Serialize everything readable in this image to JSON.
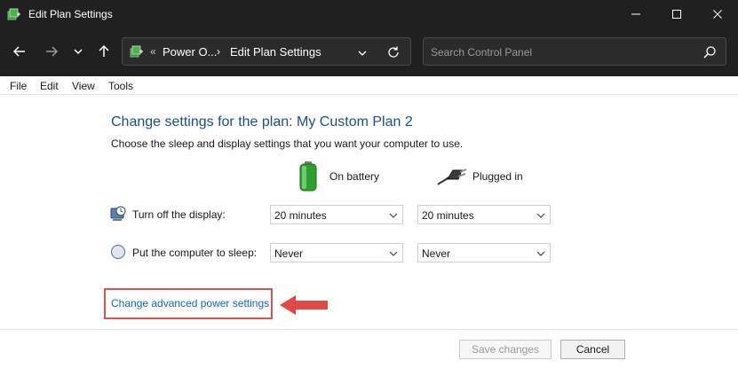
{
  "window": {
    "title": "Edit Plan Settings"
  },
  "address_bar": {
    "separator": "«",
    "crumbs": [
      "Power O...",
      "Edit Plan Settings"
    ],
    "arrow": "›"
  },
  "search": {
    "placeholder": "Search Control Panel"
  },
  "menu": {
    "items": [
      "File",
      "Edit",
      "View",
      "Tools"
    ]
  },
  "content": {
    "heading": "Change settings for the plan: My Custom Plan 2",
    "subheading": "Choose the sleep and display settings that you want your computer to use.",
    "columns": {
      "battery": "On battery",
      "plugged": "Plugged in"
    },
    "rows": [
      {
        "label": "Turn off the display:",
        "battery_value": "20 minutes",
        "plugged_value": "20 minutes",
        "icon": "display-clock-icon"
      },
      {
        "label": "Put the computer to sleep:",
        "battery_value": "Never",
        "plugged_value": "Never",
        "icon": "sleep-moon-icon"
      }
    ],
    "advanced_link": "Change advanced power settings"
  },
  "footer": {
    "save_label": "Save changes",
    "cancel_label": "Cancel"
  },
  "colors": {
    "titlebar_bg": "#202020",
    "heading": "#1e4e8c",
    "link": "#1565c0",
    "highlight": "#d9534f"
  }
}
